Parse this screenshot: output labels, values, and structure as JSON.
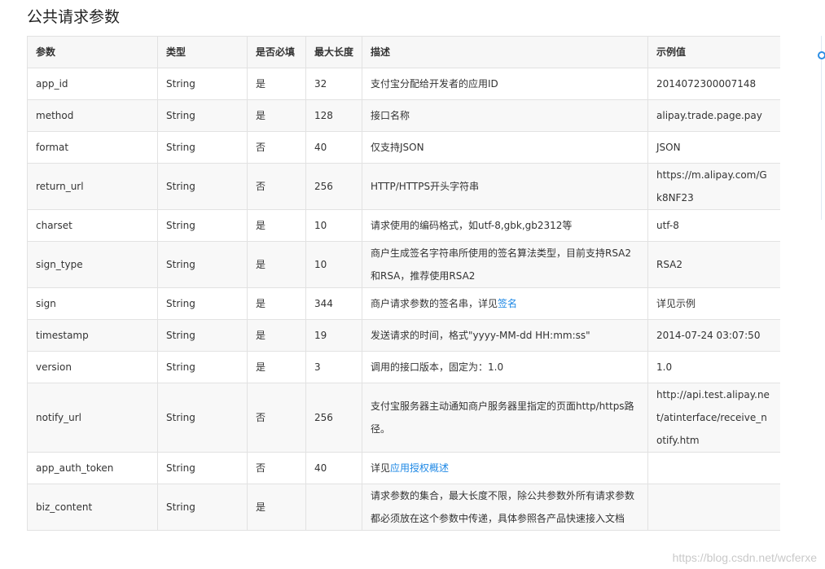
{
  "page": {
    "title": "公共请求参数",
    "watermark": "https://blog.csdn.net/wcferxe"
  },
  "table": {
    "headers": [
      "参数",
      "类型",
      "是否必填",
      "最大长度",
      "描述",
      "示例值"
    ],
    "rows": [
      {
        "param": "app_id",
        "type": "String",
        "required": "是",
        "maxlen": "32",
        "desc": "支付宝分配给开发者的应用ID",
        "example": "2014072300007148"
      },
      {
        "param": "method",
        "type": "String",
        "required": "是",
        "maxlen": "128",
        "desc": "接口名称",
        "example": "alipay.trade.page.pay"
      },
      {
        "param": "format",
        "type": "String",
        "required": "否",
        "maxlen": "40",
        "desc": "仅支持JSON",
        "example": "JSON"
      },
      {
        "param": "return_url",
        "type": "String",
        "required": "否",
        "maxlen": "256",
        "desc": "HTTP/HTTPS开头字符串",
        "example": "https://m.alipay.com/Gk8NF23"
      },
      {
        "param": "charset",
        "type": "String",
        "required": "是",
        "maxlen": "10",
        "desc": "请求使用的编码格式，如utf-8,gbk,gb2312等",
        "example": "utf-8"
      },
      {
        "param": "sign_type",
        "type": "String",
        "required": "是",
        "maxlen": "10",
        "desc": "商户生成签名字符串所使用的签名算法类型，目前支持RSA2和RSA，推荐使用RSA2",
        "example": "RSA2"
      },
      {
        "param": "sign",
        "type": "String",
        "required": "是",
        "maxlen": "344",
        "desc_prefix": "商户请求参数的签名串，详见",
        "desc_link": "签名",
        "example": "详见示例"
      },
      {
        "param": "timestamp",
        "type": "String",
        "required": "是",
        "maxlen": "19",
        "desc": "发送请求的时间，格式\"yyyy-MM-dd HH:mm:ss\"",
        "example": "2014-07-24 03:07:50"
      },
      {
        "param": "version",
        "type": "String",
        "required": "是",
        "maxlen": "3",
        "desc": "调用的接口版本，固定为：1.0",
        "example": "1.0"
      },
      {
        "param": "notify_url",
        "type": "String",
        "required": "否",
        "maxlen": "256",
        "desc": "支付宝服务器主动通知商户服务器里指定的页面http/https路径。",
        "example": "http://api.test.alipay.net/atinterface/receive_notify.htm"
      },
      {
        "param": "app_auth_token",
        "type": "String",
        "required": "否",
        "maxlen": "40",
        "desc_prefix": "详见",
        "desc_link": "应用授权概述",
        "example": ""
      },
      {
        "param": "biz_content",
        "type": "String",
        "required": "是",
        "maxlen": "",
        "desc": "请求参数的集合，最大长度不限，除公共参数外所有请求参数都必须放在这个参数中传递，具体参照各产品快速接入文档",
        "example": ""
      }
    ]
  }
}
